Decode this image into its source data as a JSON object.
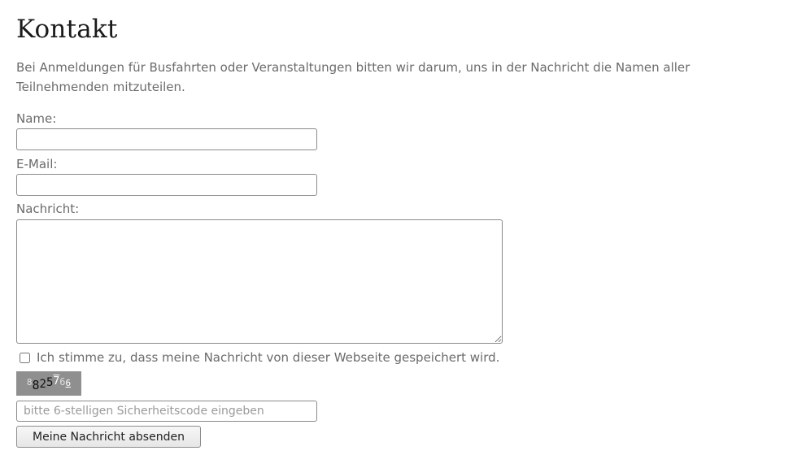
{
  "page": {
    "title": "Kontakt",
    "intro": "Bei Anmeldungen für Busfahrten oder Veranstaltungen bitten wir darum, uns in der Nachricht die Namen aller Teilnehmenden mitzuteilen."
  },
  "form": {
    "name_label": "Name:",
    "name_value": "",
    "email_label": "E-Mail:",
    "email_value": "",
    "message_label": "Nachricht:",
    "message_value": "",
    "consent_label": "Ich stimme zu, dass meine Nachricht von dieser Webseite gespeichert wird.",
    "consent_checked": false,
    "captcha_chars": [
      "8",
      "8",
      "2",
      "5",
      "7",
      "6",
      "6"
    ],
    "captcha_placeholder": "bitte 6-stelligen Sicherheitscode eingeben",
    "captcha_value": "",
    "submit_label": "Meine Nachricht absenden"
  },
  "colors": {
    "heading": "#1a1a1a",
    "text": "#6b6b6b",
    "border": "#8a8a8a",
    "captcha_bg": "#8f8f8f"
  }
}
